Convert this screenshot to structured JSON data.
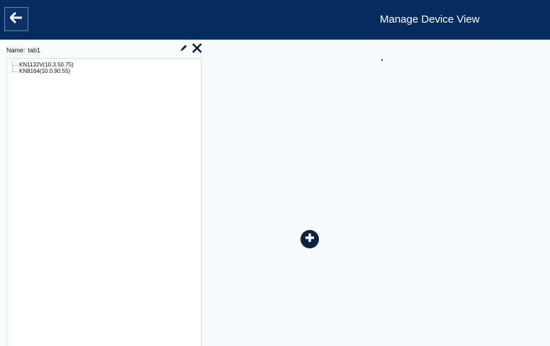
{
  "header": {
    "title": "Manage Device View",
    "back_icon": "arrow-left-icon",
    "background_color": "#062b5e"
  },
  "sidebar": {
    "name_label": "Name:",
    "name_value": "tab1",
    "edit_icon": "pencil-icon",
    "close_icon": "close-icon",
    "tree_items": [
      {
        "label": "KN1132V(10.3.50.75)"
      },
      {
        "label": "KN8164(10.0.90.55)"
      }
    ]
  },
  "main": {
    "add_icon": "plus-circle-icon"
  }
}
